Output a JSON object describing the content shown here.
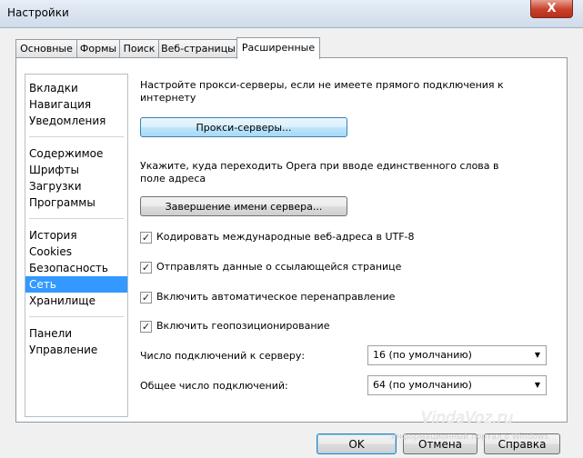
{
  "window": {
    "title": "Настройки",
    "close_label": "X"
  },
  "tabs": [
    {
      "label": "Основные"
    },
    {
      "label": "Формы"
    },
    {
      "label": "Поиск"
    },
    {
      "label": "Веб-страницы"
    },
    {
      "label": "Расширенные"
    }
  ],
  "active_tab": "Расширенные",
  "sidebar": {
    "items": [
      {
        "label": "Вкладки"
      },
      {
        "label": "Навигация"
      },
      {
        "label": "Уведомления"
      },
      {
        "label": "Содержимое"
      },
      {
        "label": "Шрифты"
      },
      {
        "label": "Загрузки"
      },
      {
        "label": "Программы"
      },
      {
        "label": "История"
      },
      {
        "label": "Cookies"
      },
      {
        "label": "Безопасность"
      },
      {
        "label": "Сеть"
      },
      {
        "label": "Хранилище"
      },
      {
        "label": "Панели"
      },
      {
        "label": "Управление"
      }
    ],
    "selected": "Сеть"
  },
  "network": {
    "proxy_text_1": "Настройте прокси-серверы, если не имеете прямого подключения к",
    "proxy_text_2": "интернету",
    "proxy_button": "Прокси-серверы...",
    "server_text_1": "Укажите, куда переходить Opera при вводе единственного слова в",
    "server_text_2": "поле адреса",
    "server_button": "Завершение имени сервера...",
    "checkboxes": [
      {
        "label": "Кодировать международные веб-адреса в UTF-8",
        "checked": true
      },
      {
        "label": "Отправлять данные о ссылающейся странице",
        "checked": true
      },
      {
        "label": "Включить автоматическое перенаправление",
        "checked": true
      },
      {
        "label": "Включить геопозиционирование",
        "checked": true
      }
    ],
    "server_connections_label": "Число подключений к серверу:",
    "server_connections_value": "16 (по умолчанию)",
    "total_connections_label": "Общее число подключений:",
    "total_connections_value": "64 (по умолчанию)"
  },
  "buttons": {
    "ok": "OK",
    "cancel": "Отмена",
    "help": "Справка"
  },
  "watermark": {
    "text": "VindaVoz.ru",
    "subtext": "информационный портал о Windows"
  },
  "colors": {
    "selection": "#3399ff",
    "titlebar": "#dfe8f2",
    "close": "#c8402a"
  }
}
